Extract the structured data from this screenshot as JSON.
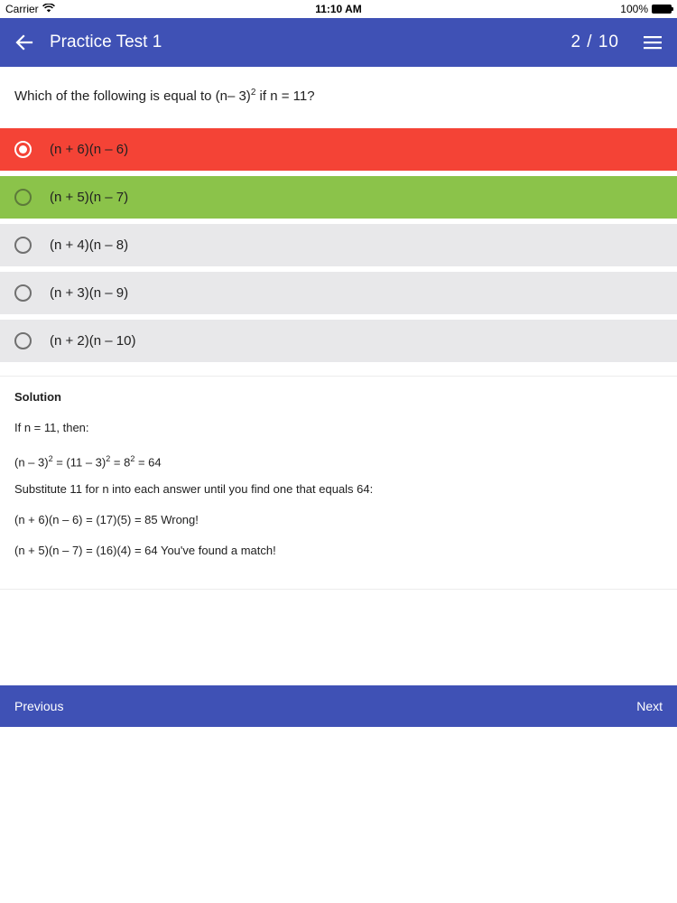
{
  "status_bar": {
    "carrier": "Carrier",
    "time": "11:10 AM",
    "battery": "100%"
  },
  "app_bar": {
    "title": "Practice Test 1",
    "counter": "2 / 10"
  },
  "question": {
    "prefix": "Which of the following is equal to (n– 3)",
    "exponent": "2",
    "suffix": " if n = 11?"
  },
  "options": [
    {
      "label": "(n + 6)(n – 6)",
      "state": "wrong-selected"
    },
    {
      "label": "(n + 5)(n – 7)",
      "state": "correct"
    },
    {
      "label": "(n + 4)(n – 8)",
      "state": "default"
    },
    {
      "label": "(n + 3)(n – 9)",
      "state": "default"
    },
    {
      "label": "(n + 2)(n – 10)",
      "state": "default"
    }
  ],
  "solution": {
    "heading": "Solution",
    "line1": "If n = 11, then:",
    "line2": {
      "a": "(n – 3)",
      "a_exp": "2",
      "b": " = (11 – 3)",
      "b_exp": "2",
      "c": " = 8",
      "c_exp": "2",
      "d": " = 64"
    },
    "line3": "Substitute 11 for n into each answer until you find one that equals 64:",
    "line4": "(n + 6)(n – 6) = (17)(5) = 85 Wrong!",
    "line5": "(n + 5)(n – 7) = (16)(4) = 64 You've found a match!"
  },
  "bottom_bar": {
    "previous": "Previous",
    "next": "Next"
  },
  "colors": {
    "primary": "#3F51B5",
    "wrong": "#F44336",
    "correct": "#8BC34A",
    "option_bg": "#E8E8EA"
  }
}
